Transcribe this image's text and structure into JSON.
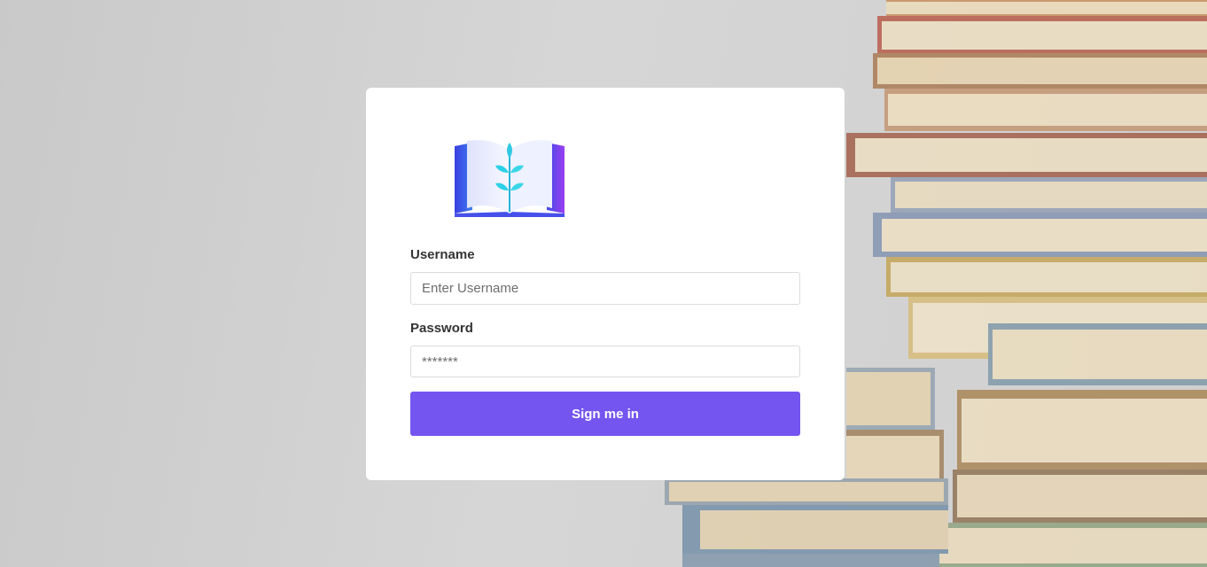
{
  "logo": {
    "icon": "open-book-sprout-icon",
    "colors": {
      "blue": "#3a55e6",
      "purple": "#9b3ff0",
      "teal": "#2bd1e6"
    }
  },
  "form": {
    "username_label": "Username",
    "username_placeholder": "Enter Username",
    "username_value": "",
    "password_label": "Password",
    "password_placeholder": "*******",
    "password_value": "",
    "submit_label": "Sign me in"
  },
  "colors": {
    "accent": "#7455ef",
    "card": "#ffffff",
    "background": "#d0d0d0"
  }
}
